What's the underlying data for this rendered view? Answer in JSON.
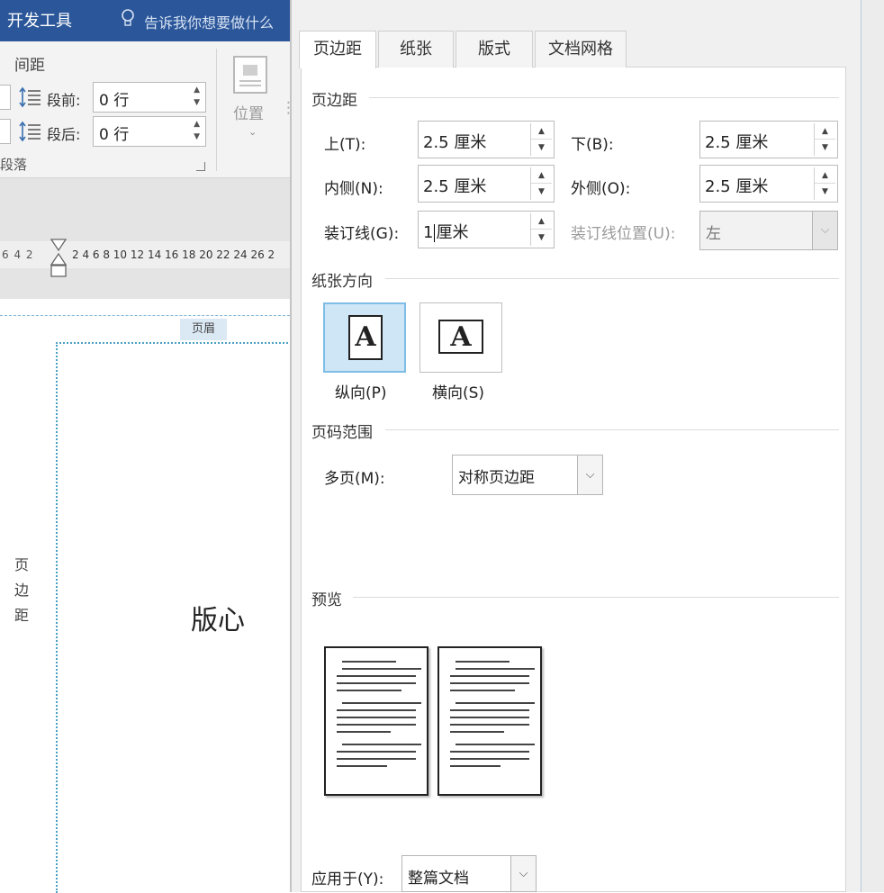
{
  "background_app": {
    "ribbon_tab": "开发工具",
    "tell_me_placeholder": "告诉我你想要做什么",
    "spacing_group_title": "间距",
    "spacing_before": {
      "label": "段前:",
      "value": "0 行"
    },
    "spacing_after": {
      "label": "段后:",
      "value": "0 行"
    },
    "paragraph_group_label": "段落",
    "position_button_label": "位置",
    "ruler_left_numbers": "6 4 2",
    "ruler_numbers": "2 4 6 8 10 12 14 16 18 20 22 24 26 2",
    "header_tag": "页眉",
    "margin_label": "页边距",
    "body_label": "版心"
  },
  "dialog": {
    "tabs": [
      {
        "label": "页边距",
        "active": true
      },
      {
        "label": "纸张",
        "active": false
      },
      {
        "label": "版式",
        "active": false
      },
      {
        "label": "文档网格",
        "active": false
      }
    ],
    "margins_section": "页边距",
    "fields": {
      "top": {
        "label": "上(T):",
        "value": "2.5 厘米"
      },
      "bottom": {
        "label": "下(B):",
        "value": "2.5 厘米"
      },
      "inside": {
        "label": "内侧(N):",
        "value": "2.5 厘米"
      },
      "outside": {
        "label": "外侧(O):",
        "value": "2.5 厘米"
      },
      "gutter": {
        "label": "装订线(G):",
        "value_before_caret": "1",
        "value_after_caret": "厘米"
      },
      "gutter_position": {
        "label": "装订线位置(U):",
        "value": "左",
        "disabled": true
      }
    },
    "orientation_section": "纸张方向",
    "orientation": {
      "portrait_label": "纵向(P)",
      "landscape_label": "横向(S)",
      "icon_letter": "A",
      "selected": "portrait"
    },
    "pages_section": "页码范围",
    "multiple_pages": {
      "label": "多页(M):",
      "value": "对称页边距"
    },
    "preview_section": "预览",
    "apply_to": {
      "label": "应用于(Y):",
      "value": "整篇文档"
    }
  },
  "colors": {
    "title_bar": "#2b579a",
    "selection_fill": "#cfe6f7",
    "selection_border": "#7ebde6",
    "guide_dotted": "#4a9fc2"
  }
}
